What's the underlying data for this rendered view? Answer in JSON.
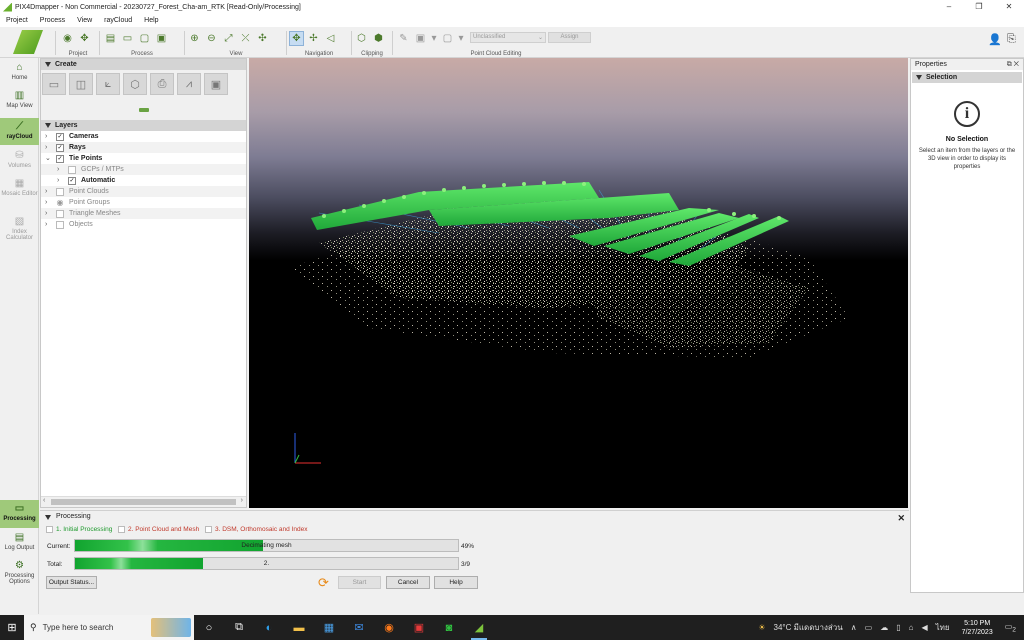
{
  "window": {
    "title": "PIX4Dmapper - Non Commercial - 20230727_Forest_Cha-am_RTK [Read-Only/Processing]",
    "minimize": "–",
    "maximize": "❐",
    "close": "✕"
  },
  "menu": [
    "Project",
    "Process",
    "View",
    "rayCloud",
    "Help"
  ],
  "toolbar": {
    "groups": {
      "project": "Project",
      "process": "Process",
      "view": "View",
      "navigation": "Navigation",
      "clipping": "Clipping",
      "point_cloud_editing": "Point Cloud Editing"
    },
    "class_dropdown": "Unclassified",
    "assign_label": "Assign"
  },
  "nav": {
    "home": "Home",
    "map_view": "Map View",
    "raycloud": "rayCloud",
    "volumes": "Volumes",
    "mosaic_editor": "Mosaic Editor",
    "index_calculator": "Index Calculator",
    "processing": "Processing",
    "log_output": "Log Output",
    "processing_options": "Processing Options"
  },
  "create_panel": {
    "title": "Create"
  },
  "layers_panel": {
    "title": "Layers",
    "items": [
      {
        "label": "Cameras",
        "checked": true
      },
      {
        "label": "Rays",
        "checked": true
      },
      {
        "label": "Tie Points",
        "checked": true
      },
      {
        "label": "GCPs / MTPs",
        "checked": false
      },
      {
        "label": "Automatic",
        "checked": true
      },
      {
        "label": "Point Clouds",
        "checked": false
      },
      {
        "label": "Point Groups",
        "checked": false
      },
      {
        "label": "Triangle Meshes",
        "checked": false
      },
      {
        "label": "Objects",
        "checked": false
      }
    ]
  },
  "properties": {
    "title": "Properties",
    "section": "Selection",
    "no_selection": "No Selection",
    "message": "Select an item from the layers or the 3D view in order to display its properties"
  },
  "processing": {
    "title": "Processing",
    "steps": [
      {
        "label": "1. Initial Processing",
        "color": "#1f9a2e"
      },
      {
        "label": "2. Point Cloud and Mesh",
        "color": "#c0392b"
      },
      {
        "label": "3. DSM, Orthomosaic and Index",
        "color": "#c0392b"
      }
    ],
    "current_label": "Current:",
    "current_text": "Decimating mesh",
    "current_fraction": 0.49,
    "current_pct": "49%",
    "total_label": "Total:",
    "total_text": "2.",
    "total_fraction": 0.333,
    "total_count": "3/9",
    "output_status": "Output Status...",
    "start": "Start",
    "cancel": "Cancel",
    "help": "Help"
  },
  "taskbar": {
    "search_placeholder": "Type here to search",
    "weather": "34°C  มีแดดบางส่วน",
    "lang": "ไทย",
    "time": "5:10 PM",
    "date": "7/27/2023",
    "notif": "2"
  }
}
